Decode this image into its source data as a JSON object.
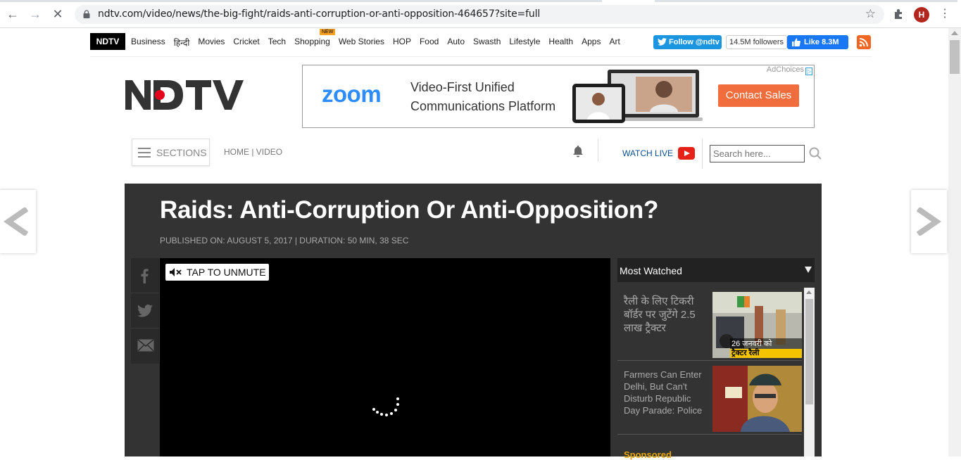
{
  "browser": {
    "url": "ndtv.com/video/news/the-big-fight/raids-anti-corruption-or-anti-opposition-464657?site=full",
    "avatar_letter": "H"
  },
  "topnav": {
    "brand": "NDTV",
    "links": [
      "Business",
      "हिन्दी",
      "Movies",
      "Cricket",
      "Tech",
      "Shopping",
      "Web Stories",
      "HOP",
      "Food",
      "Auto",
      "Swasth",
      "Lifestyle",
      "Health",
      "Apps",
      "Art"
    ],
    "new_badge": "NEW",
    "twitter_follow": "Follow @ndtv",
    "twitter_count": "14.5M followers",
    "fb_like": "Like 8.3M"
  },
  "ad": {
    "brand": "zoom",
    "headline": "Video-First Unified Communications Platform",
    "cta": "Contact Sales",
    "adchoices": "AdChoices"
  },
  "header": {
    "sections_label": "SECTIONS",
    "breadcrumb": "HOME | VIDEO",
    "watch_live": "WATCH LIVE",
    "search_placeholder": "Search here..."
  },
  "video": {
    "title": "Raids: Anti-Corruption Or Anti-Opposition?",
    "meta": "PUBLISHED ON: AUGUST 5, 2017 | DURATION: 50 MIN, 38 SEC",
    "unmute_label": "TAP TO UNMUTE"
  },
  "most_watched": {
    "heading": "Most Watched",
    "items": [
      {
        "title": "रैली के लिए टिकरी बॉर्डर पर जुटेंगे 2.5 लाख ट्रैक्टर",
        "thumb_caption_top": "26 जनवरी को",
        "thumb_caption_bottom": "ट्रैक्टर रैली"
      },
      {
        "title": "Farmers Can Enter Delhi, But Can't Disturb Republic Day Parade: Police"
      }
    ],
    "sponsored_label": "Sponsored"
  },
  "colors": {
    "accent_red": "#e3001b",
    "twitter_blue": "#1b95e0",
    "facebook_blue": "#1877f2",
    "zoom_blue": "#2d8cff",
    "cta_orange": "#f26d3d",
    "panel_bg": "#333333"
  }
}
